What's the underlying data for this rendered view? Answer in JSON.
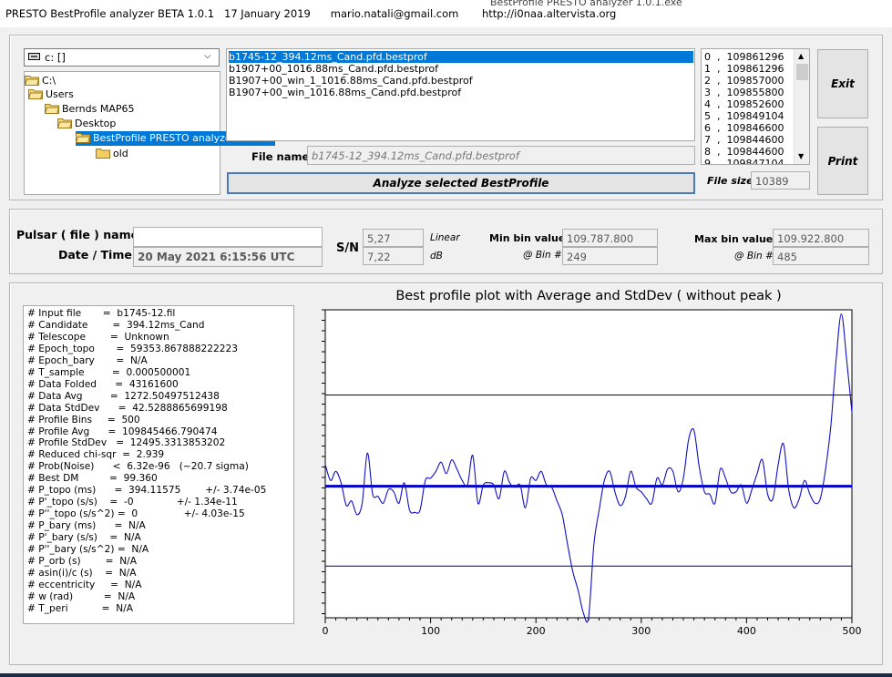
{
  "window": {
    "title": "PRESTO BestProfile analyzer BETA 1.0.1   17 January 2019      mario.natali@gmail.com       http://i0naa.altervista.org",
    "behind_title": "BestProfile PRESTO analyzer 1.0.1.exe"
  },
  "drive": {
    "label": "c: []"
  },
  "dirs": [
    {
      "label": "C:\\",
      "selected": false
    },
    {
      "label": "Users",
      "selected": false
    },
    {
      "label": "Bernds MAP65",
      "selected": false
    },
    {
      "label": "Desktop",
      "selected": false
    },
    {
      "label": "BestProfile PRESTO analyzer 1.0.1.e",
      "selected": true
    },
    {
      "label": "old",
      "selected": false
    }
  ],
  "files": [
    "b1745-12_394.12ms_Cand.pfd.bestprof",
    "b1907+00_1016.88ms_Cand.pfd.bestprof",
    "B1907+00_win_1_1016.88ms_Cand.pfd.bestprof",
    "B1907+00_win_1016.88ms_Cand.pfd.bestprof"
  ],
  "values": [
    "0  ,  109861296",
    "1  ,  109861296",
    "2  ,  109857000",
    "3  ,  109855800",
    "4  ,  109852600",
    "5  ,  109849104",
    "6  ,  109846600",
    "7  ,  109844600",
    "8  ,  109844600",
    "9  ,  109847104"
  ],
  "buttons": {
    "exit": "Exit",
    "print": "Print",
    "analyze": "Analyze selected BestProfile"
  },
  "file_name": {
    "label": "File name",
    "value": "b1745-12_394.12ms_Cand.pfd.bestprof"
  },
  "file_size": {
    "label": "File size",
    "value": "10389"
  },
  "pulsar": {
    "label": "Pulsar ( file ) name",
    "value": ""
  },
  "datetime": {
    "label": "Date / Time",
    "value": "20 May 2021     6:15:56  UTC"
  },
  "sn": {
    "label": "S/N",
    "linear": "5,27",
    "linear_label": "Linear",
    "db": "7,22",
    "db_label": "dB"
  },
  "min_bin": {
    "label": "Min bin value",
    "value": "109.787.800",
    "bin_label": "@ Bin #",
    "bin": "249"
  },
  "max_bin": {
    "label": "Max bin value",
    "value": "109.922.800",
    "bin_label": "@ Bin #",
    "bin": "485"
  },
  "info_lines": [
    "# Input file       =  b1745-12.fil",
    "# Candidate        =  394.12ms_Cand",
    "# Telescope        =  Unknown",
    "# Epoch_topo       =  59353.867888222223",
    "# Epoch_bary       =  N/A",
    "# T_sample         =  0.000500001",
    "# Data Folded      =  43161600",
    "# Data Avg         =  1272.50497512438",
    "# Data StdDev      =  42.5288865699198",
    "# Profile Bins     =  500",
    "# Profile Avg      =  109845466.790474",
    "# Profile StdDev   =  12495.3313853202",
    "# Reduced chi-sqr  =  2.939",
    "# Prob(Noise)      <  6.32e-96   (~20.7 sigma)",
    "# Best DM          =  99.360",
    "# P_topo (ms)      =  394.11575        +/- 3.74e-05",
    "# P'_topo (s/s)    =  -0              +/- 1.34e-11",
    "# P''_topo (s/s^2) =  0               +/- 4.03e-15",
    "# P_bary (ms)      =  N/A",
    "# P'_bary (s/s)    =  N/A",
    "# P''_bary (s/s^2) =  N/A",
    "# P_orb (s)        =  N/A",
    "# asin(i)/c (s)    =  N/A",
    "# eccentricity     =  N/A",
    "# w (rad)          =  N/A",
    "# T_peri           =  N/A"
  ],
  "chart_data": {
    "type": "line",
    "title": "Best profile plot with  Average and StdDev ( without peak )",
    "xlim": [
      0,
      500
    ],
    "x_ticks": [
      0,
      100,
      200,
      300,
      400,
      500
    ],
    "x_tick_labels": [
      "0",
      "100",
      "200",
      "300",
      "400",
      "500"
    ],
    "ylim": [
      109787800,
      109922800
    ],
    "avg": 109845466.79,
    "std": 12495.33,
    "series": [
      {
        "color": "#1010c0",
        "x": [
          0,
          5,
          10,
          15,
          20,
          25,
          30,
          35,
          40,
          45,
          50,
          55,
          60,
          65,
          70,
          75,
          80,
          85,
          90,
          95,
          100,
          105,
          110,
          115,
          120,
          125,
          130,
          135,
          140,
          145,
          150,
          155,
          160,
          165,
          170,
          175,
          180,
          185,
          190,
          195,
          200,
          205,
          210,
          215,
          220,
          225,
          230,
          235,
          240,
          245,
          250,
          255,
          260,
          265,
          270,
          275,
          280,
          285,
          290,
          295,
          300,
          305,
          310,
          315,
          320,
          325,
          330,
          335,
          340,
          345,
          350,
          355,
          360,
          365,
          370,
          375,
          380,
          385,
          390,
          395,
          400,
          405,
          410,
          415,
          420,
          425,
          430,
          435,
          440,
          445,
          450,
          455,
          460,
          465,
          470,
          475,
          480,
          485,
          490,
          495,
          500
        ],
        "y": [
          109855000,
          109848000,
          109852000,
          109847000,
          109837000,
          109839000,
          109833000,
          109838000,
          109860000,
          109842000,
          109841000,
          109838000,
          109844000,
          109843000,
          109838000,
          109847000,
          109835000,
          109834000,
          109835000,
          109848000,
          109849000,
          109852000,
          109856000,
          109851000,
          109857000,
          109853000,
          109848000,
          109846000,
          109859000,
          109838000,
          109846000,
          109847000,
          109846000,
          109840000,
          109852000,
          109847000,
          109845000,
          109846000,
          109836000,
          109849000,
          109848000,
          109852000,
          109846000,
          109845000,
          109839000,
          109833000,
          109820000,
          109808000,
          109800000,
          109790000,
          109788000,
          109820000,
          109835000,
          109848000,
          109852000,
          109843000,
          109837000,
          109841000,
          109852000,
          109845000,
          109843000,
          109840000,
          109838000,
          109849000,
          109846000,
          109853000,
          109852000,
          109843000,
          109849000,
          109866000,
          109870000,
          109854000,
          109843000,
          109842000,
          109838000,
          109853000,
          109849000,
          109843000,
          109843000,
          109846000,
          109838000,
          109844000,
          109851000,
          109857000,
          109842000,
          109840000,
          109855000,
          109864000,
          109844000,
          109836000,
          109840000,
          109848000,
          109842000,
          109838000,
          109840000,
          109853000,
          109872000,
          109901000,
          109921000,
          109901000,
          109878000
        ]
      }
    ]
  }
}
